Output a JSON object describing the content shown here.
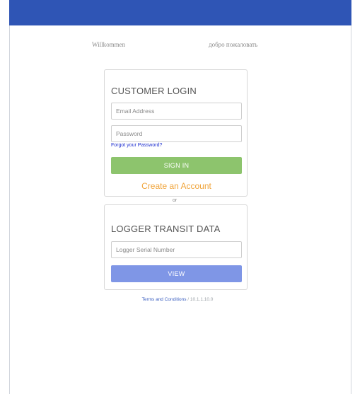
{
  "header": {
    "color": "#2f55b5"
  },
  "welcome": {
    "left": "Willkommen",
    "right": "добро пожаловать"
  },
  "login": {
    "title": "CUSTOMER LOGIN",
    "email_placeholder": "Email Address",
    "password_placeholder": "Password",
    "forgot_label": "Forgot your Password?",
    "signin_label": "SIGN IN",
    "create_label": "Create an Account"
  },
  "divider": {
    "or_label": "or"
  },
  "logger": {
    "title": "LOGGER TRANSIT DATA",
    "serial_placeholder": "Logger Serial Number",
    "view_label": "VIEW"
  },
  "footer": {
    "terms_label": "Terms and Conditions",
    "version": "/ 10.1.1.10.0"
  },
  "colors": {
    "signin": "#8dc46d",
    "view": "#7f96e6",
    "create": "#f0a43a",
    "link": "#1e2fd0"
  }
}
